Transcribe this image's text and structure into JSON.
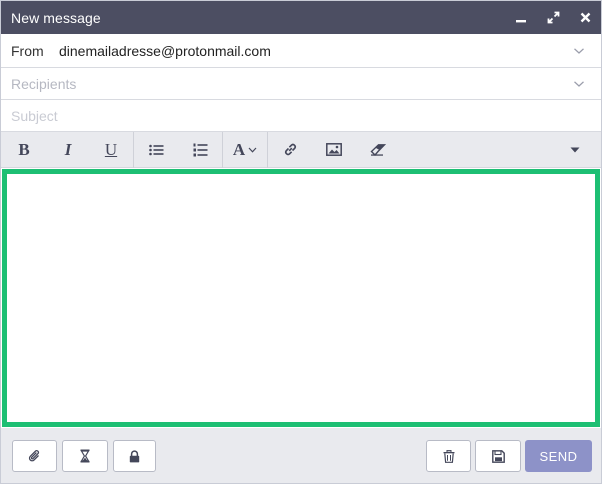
{
  "window": {
    "title": "New message",
    "controls": [
      "minimize-icon",
      "expand-icon",
      "close-icon"
    ]
  },
  "from": {
    "label": "From",
    "value": "dinemailadresse@protonmail.com"
  },
  "recipients": {
    "placeholder": "Recipients"
  },
  "subject": {
    "placeholder": "Subject"
  },
  "toolbar": {
    "bold": "B",
    "italic": "I",
    "underline": "U",
    "font_size": "A",
    "icons": [
      "bold-icon",
      "italic-icon",
      "underline-icon",
      "bullet-list-icon",
      "numbered-list-icon",
      "font-size-icon",
      "link-icon",
      "image-icon",
      "eraser-icon",
      "more-icon"
    ]
  },
  "editor": {
    "content": "",
    "border_color": "#1dbf73"
  },
  "footer": {
    "icons": [
      "paperclip-icon",
      "hourglass-icon",
      "lock-icon",
      "trash-icon",
      "save-icon"
    ],
    "send_label": "SEND"
  },
  "colors": {
    "titlebar": "#4c4e62",
    "toolbar": "#e9eaee",
    "send_button": "#8d92c8",
    "editor_focus": "#1dbf73"
  }
}
